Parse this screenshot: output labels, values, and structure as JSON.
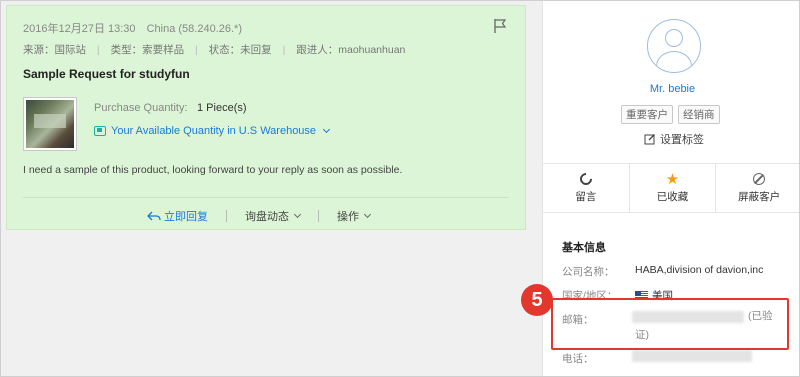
{
  "message": {
    "date": "2016年12月27日 13:30",
    "origin": "China (58.240.26.*)",
    "source_label": "来源：",
    "source_value": "国际站",
    "type_label": "类型：",
    "type_value": "索要样品",
    "status_label": "状态：",
    "status_value": "未回复",
    "follower_label": "跟进人：",
    "follower_value": "maohuanhuan",
    "subject": "Sample Request for studyfun",
    "quantity_label": "Purchase Quantity:",
    "quantity_value": "1 Piece(s)",
    "available_link": "Your Available Quantity in U.S Warehouse",
    "body": "I need a sample of this product, looking forward to your reply as soon as possible.",
    "actions": {
      "reply": "立即回复",
      "inquiry": "询盘动态",
      "operate": "操作"
    }
  },
  "contact": {
    "name": "Mr. bebie",
    "tags": [
      "重要客户",
      "经销商"
    ],
    "set_tags": "设置标签",
    "actions": {
      "message": "留言",
      "favorited": "已收藏",
      "block": "屏蔽客户"
    },
    "info_title": "基本信息",
    "company_label": "公司名称：",
    "company_value": "HABA,division of davion,inc",
    "country_label": "国家/地区：",
    "country_value": "美国",
    "email_label": "邮箱：",
    "email_verified_part1": "(已验",
    "email_verified_part2": "证)",
    "phone_label": "电话："
  },
  "annotation": {
    "step": "5",
    "color": "#e3372e"
  },
  "colors": {
    "card_bg": "#dcf5d6",
    "link": "#1a7ad8",
    "star": "#f39c12"
  }
}
